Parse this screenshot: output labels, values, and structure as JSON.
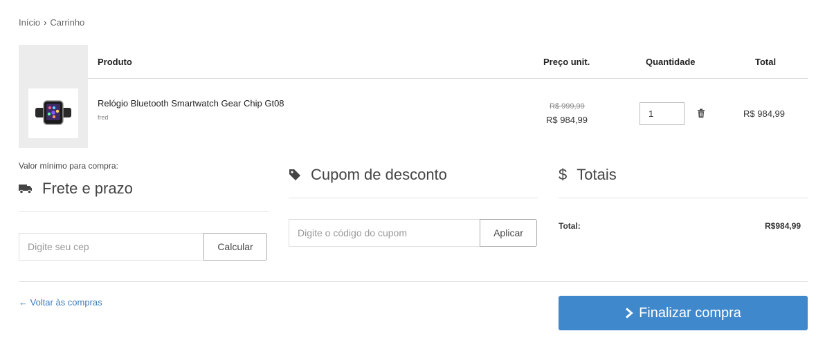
{
  "breadcrumb": {
    "home": "Início",
    "separator": "›",
    "current": "Carrinho"
  },
  "table": {
    "headers": {
      "product": "Produto",
      "unit_price": "Preço unit.",
      "quantity": "Quantidade",
      "total": "Total"
    },
    "rows": [
      {
        "name": "Relógio Bluetooth Smartwatch Gear Chip Gt08",
        "seller": "fred",
        "old_price": "R$ 999,99",
        "price": "R$ 984,99",
        "quantity": "1",
        "total": "R$ 984,99"
      }
    ]
  },
  "shipping": {
    "min_label": "Valor mínimo para compra:",
    "title": "Frete e prazo",
    "placeholder": "Digite seu cep",
    "button": "Calcular"
  },
  "coupon": {
    "title": "Cupom de desconto",
    "placeholder": "Digite o código do cupom",
    "button": "Aplicar"
  },
  "totals": {
    "title": "Totais",
    "label": "Total:",
    "value": "R$984,99"
  },
  "footer": {
    "back_link": "← Voltar às compras",
    "checkout": "Finalizar compra"
  },
  "colors": {
    "accent": "#3f88cc",
    "link": "#3a7bbf"
  }
}
